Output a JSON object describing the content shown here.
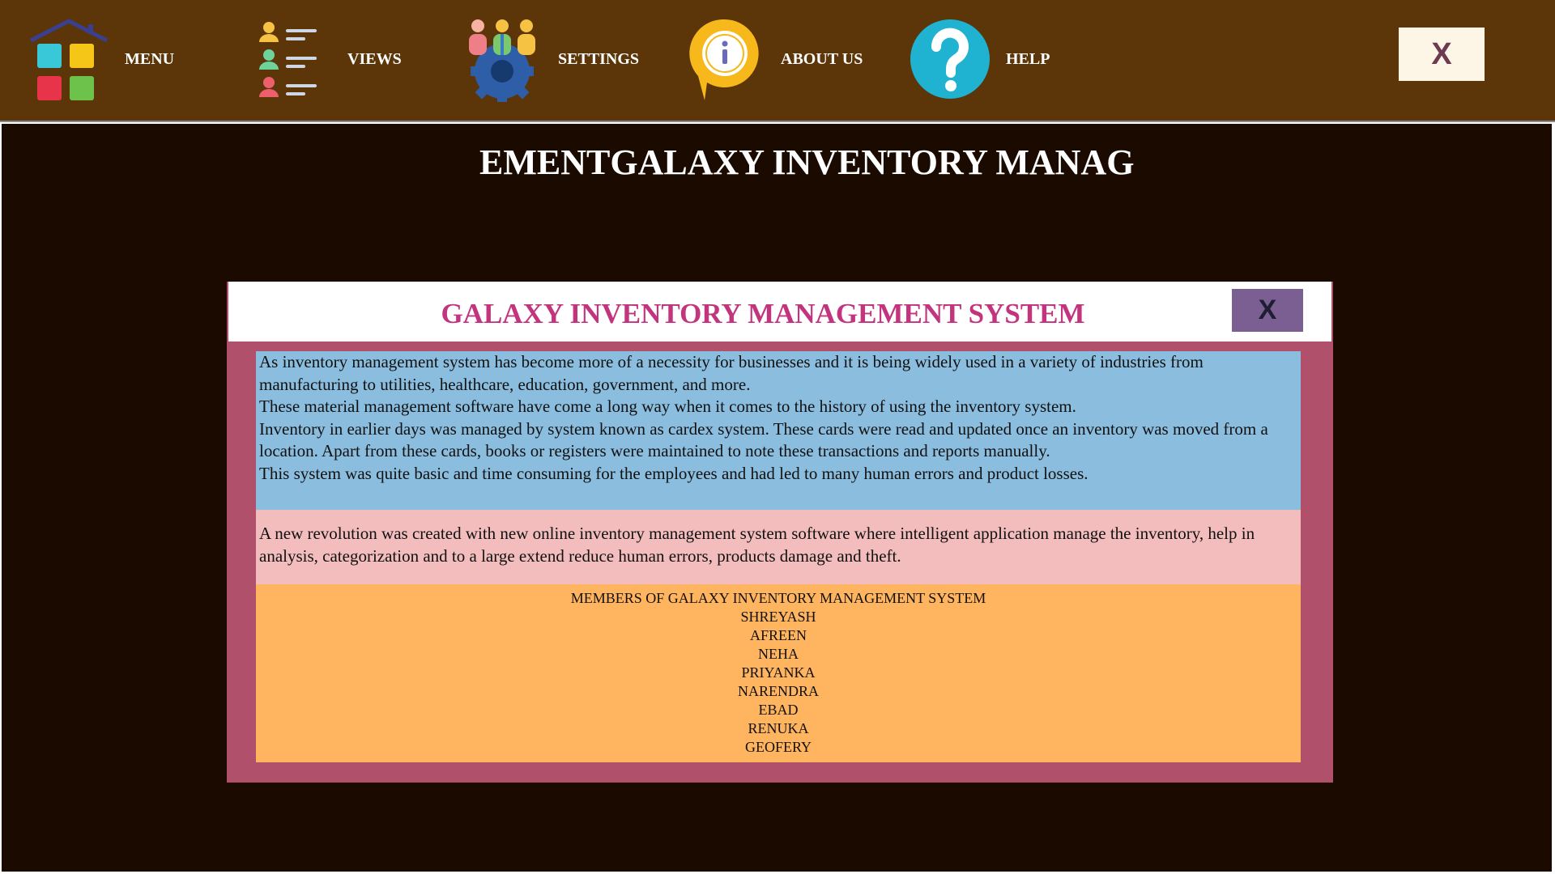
{
  "toolbar": {
    "items": [
      {
        "label": "MENU",
        "icon": "apps-grid-icon"
      },
      {
        "label": "VIEWS",
        "icon": "user-list-icon"
      },
      {
        "label": "SETTINGS",
        "icon": "team-gear-icon"
      },
      {
        "label": "ABOUT US",
        "icon": "info-icon"
      },
      {
        "label": "HELP",
        "icon": "help-icon"
      }
    ],
    "close_label": "X"
  },
  "background": {
    "title": "EMENTGALAXY INVENTORY MANAG"
  },
  "dialog": {
    "title": "GALAXY INVENTORY MANAGEMENT SYSTEM",
    "close_label": "X",
    "intro_paragraphs": [
      "As inventory management system has become more of a necessity for businesses and it is being widely used in a variety of industries from manufacturing to utilities, healthcare, education, government, and more.",
      "These material management software have come a long way when it comes to the history of using the inventory system.",
      "Inventory in earlier days was managed by system known as cardex system. These cards were read and updated once an inventory was moved from a location. Apart from these cards, books or registers were maintained to note these transactions and reports manually.",
      "This system was quite basic and time consuming for the employees and had led to many human errors and product losses."
    ],
    "revolution_text": "A new revolution was created with new online inventory management system software where intelligent application manage the inventory, help in analysis, categorization and to a large extend reduce human errors, products damage and theft.",
    "members_heading": "MEMBERS OF GALAXY INVENTORY MANAGEMENT SYSTEM",
    "members": [
      "SHREYASH",
      "AFREEN",
      "NEHA",
      "PRIYANKA",
      "NARENDRA",
      "EBAD",
      "RENUKA",
      "GEOFERY"
    ]
  },
  "colors": {
    "toolbar_bg": "#5c3608",
    "main_bg": "#1a0a00",
    "dialog_frame": "#b0506a",
    "dialog_title": "#c2357e",
    "panel_blue": "#8bbddf",
    "panel_pink": "#f3bdbd",
    "panel_orange": "#ffb45f",
    "dialog_close_bg": "#7b5f93"
  }
}
